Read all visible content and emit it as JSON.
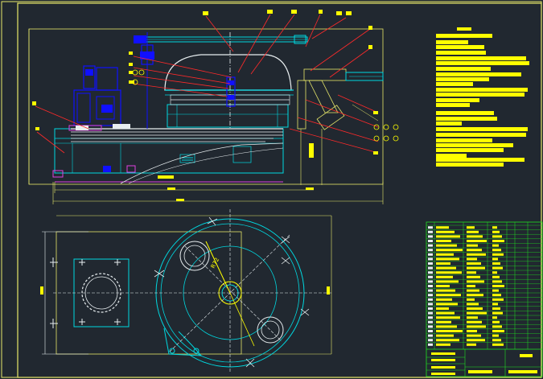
{
  "drawing": {
    "background": "#212830",
    "palette": {
      "frame": "#e8e86a",
      "cyan": "#00d8e0",
      "white": "#e8eef0",
      "blue": "#1010ff",
      "leader": "#ff2a2a",
      "note": "#ffff00",
      "magenta": "#e040e0",
      "green": "#20e020",
      "gray": "#9aa4ac"
    },
    "dimension_label_with_text": "R72",
    "table_numbers": [
      "1",
      "2",
      "3",
      "4",
      "5",
      "6",
      "7",
      "8",
      "9",
      "10",
      "11",
      "12",
      "13",
      "14",
      "15",
      "16",
      "17",
      "18",
      "19",
      "20",
      "21",
      "22",
      "23",
      "24",
      "25",
      "26",
      "27"
    ]
  }
}
